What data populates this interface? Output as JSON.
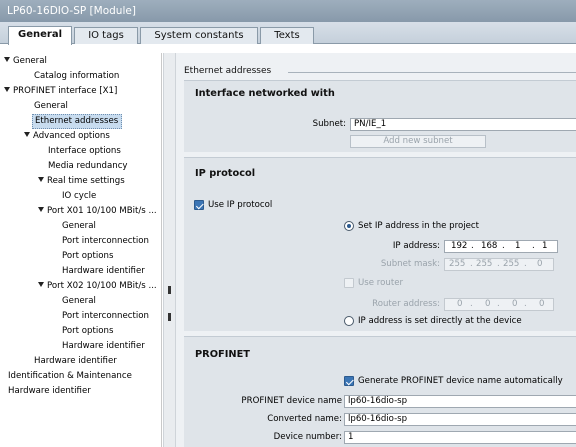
{
  "window": {
    "title": "LP60-16DIO-SP [Module]"
  },
  "tabs": [
    {
      "label": "General",
      "active": true
    },
    {
      "label": "IO tags",
      "active": false
    },
    {
      "label": "System constants",
      "active": false
    },
    {
      "label": "Texts",
      "active": false
    }
  ],
  "nav": {
    "items": [
      {
        "label": "General",
        "expanded": true
      },
      {
        "label": "Catalog information"
      },
      {
        "label": "PROFINET interface [X1]",
        "expanded": true
      },
      {
        "label": "General"
      },
      {
        "label": "Ethernet addresses",
        "selected": true
      },
      {
        "label": "Advanced options",
        "expanded": true
      },
      {
        "label": "Interface options"
      },
      {
        "label": "Media redundancy"
      },
      {
        "label": "Real time settings",
        "expanded": true
      },
      {
        "label": "IO cycle"
      },
      {
        "label": "Port X01 10/100 MBit/s ...",
        "expanded": true
      },
      {
        "label": "General"
      },
      {
        "label": "Port interconnection"
      },
      {
        "label": "Port options"
      },
      {
        "label": "Hardware identifier"
      },
      {
        "label": "Port X02 10/100 MBit/s ...",
        "expanded": true
      },
      {
        "label": "General"
      },
      {
        "label": "Port interconnection"
      },
      {
        "label": "Port options"
      },
      {
        "label": "Hardware identifier"
      },
      {
        "label": "Hardware identifier"
      },
      {
        "label": "Identification & Maintenance"
      },
      {
        "label": "Hardware identifier"
      }
    ]
  },
  "content": {
    "section_title": "Ethernet addresses",
    "interface": {
      "title": "Interface networked with",
      "subnet_label": "Subnet:",
      "subnet_value": "PN/IE_1",
      "add_subnet_button": "Add new subnet"
    },
    "ip_protocol": {
      "title": "IP protocol",
      "use_ip_label": "Use IP protocol",
      "use_ip_checked": true,
      "set_in_project_label": "Set IP address in the project",
      "set_in_project_selected": true,
      "ip_address_label": "IP address:",
      "ip_address": [
        "192",
        "168",
        "1",
        "1"
      ],
      "subnet_mask_label": "Subnet mask:",
      "subnet_mask": [
        "255",
        "255",
        "255",
        "0"
      ],
      "use_router_label": "Use router",
      "use_router_checked": false,
      "router_address_label": "Router address:",
      "router_address": [
        "0",
        "0",
        "0",
        "0"
      ],
      "set_directly_label": "IP address is set directly at the device",
      "set_directly_selected": false
    },
    "profinet": {
      "title": "PROFINET",
      "auto_name_label": "Generate PROFINET device name automatically",
      "auto_name_checked": true,
      "device_name_label": "PROFINET device name",
      "device_name": "lp60-16dio-sp",
      "converted_name_label": "Converted name:",
      "converted_name": "lp60-16dio-sp",
      "device_number_label": "Device number:",
      "device_number": "1"
    }
  },
  "colors": {
    "title_bar": "#9eaebd",
    "selected_item": "#c8dcef",
    "panel_bg": "#dfe4e9",
    "checkbox_on": "#3b75b5"
  }
}
